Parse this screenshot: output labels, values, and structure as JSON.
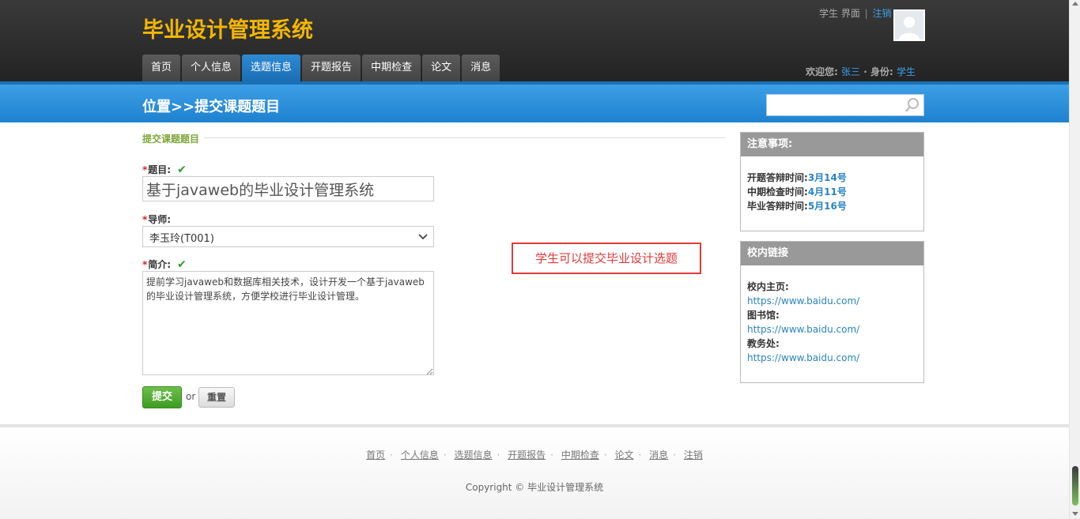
{
  "app": {
    "title": "毕业设计管理系统"
  },
  "header": {
    "role_text": "学生 界面",
    "logout": "注销",
    "welcome_label": "欢迎您:",
    "user_name": "张三",
    "identity_label": "· 身份:",
    "identity_value": "学生"
  },
  "nav": {
    "tabs": [
      {
        "label": "首页"
      },
      {
        "label": "个人信息"
      },
      {
        "label": "选题信息"
      },
      {
        "label": "开题报告"
      },
      {
        "label": "中期检查"
      },
      {
        "label": "论文"
      },
      {
        "label": "消息"
      }
    ],
    "active_index": 2
  },
  "band": {
    "title": "位置>>提交课题题目",
    "search_placeholder": ""
  },
  "form": {
    "section_title": "提交课题题目",
    "title_label": "题目:",
    "title_value": "基于javaweb的毕业设计管理系统",
    "advisor_label": "导师:",
    "advisor_value": "李玉玲(T001)",
    "intro_label": "简介:",
    "intro_value": "提前学习javaweb和数据库相关技术，设计开发一个基于javaweb的毕业设计管理系统，方便学校进行毕业设计管理。",
    "submit_label": "提交",
    "or_text": "or",
    "reset_label": "重置",
    "required_mark": "*",
    "check_mark": "✔"
  },
  "annotation": {
    "text": "学生可以提交毕业设计选题"
  },
  "sidebar": {
    "notice": {
      "title": "注意事项:",
      "items": [
        {
          "key": "开题答辩时间:",
          "value": "3月14号"
        },
        {
          "key": "中期检查时间:",
          "value": "4月11号"
        },
        {
          "key": "毕业答辩时间:",
          "value": "5月16号"
        }
      ]
    },
    "links": {
      "title": "校内链接",
      "items": [
        {
          "key": "校内主页:",
          "url": "https://www.baidu.com/"
        },
        {
          "key": "图书馆:",
          "url": "https://www.baidu.com/"
        },
        {
          "key": "教务处:",
          "url": "https://www.baidu.com/"
        }
      ]
    }
  },
  "footer": {
    "links": [
      "首页",
      "个人信息",
      "选题信息",
      "开题报告",
      "中期检查",
      "论文",
      "消息",
      "注销"
    ],
    "separator": "·",
    "copyright": "Copyright © 毕业设计管理系统"
  },
  "colors": {
    "logo": "#f5b700",
    "accent_blue": "#1f82cf",
    "active_tab": "#2e8ad4",
    "submit_green": "#3e9b23",
    "annotation_red": "#e03a3a"
  },
  "icons": {
    "search": "search-icon",
    "avatar": "avatar-placeholder-icon",
    "check": "check-icon",
    "dropdown": "chevron-down-icon"
  }
}
